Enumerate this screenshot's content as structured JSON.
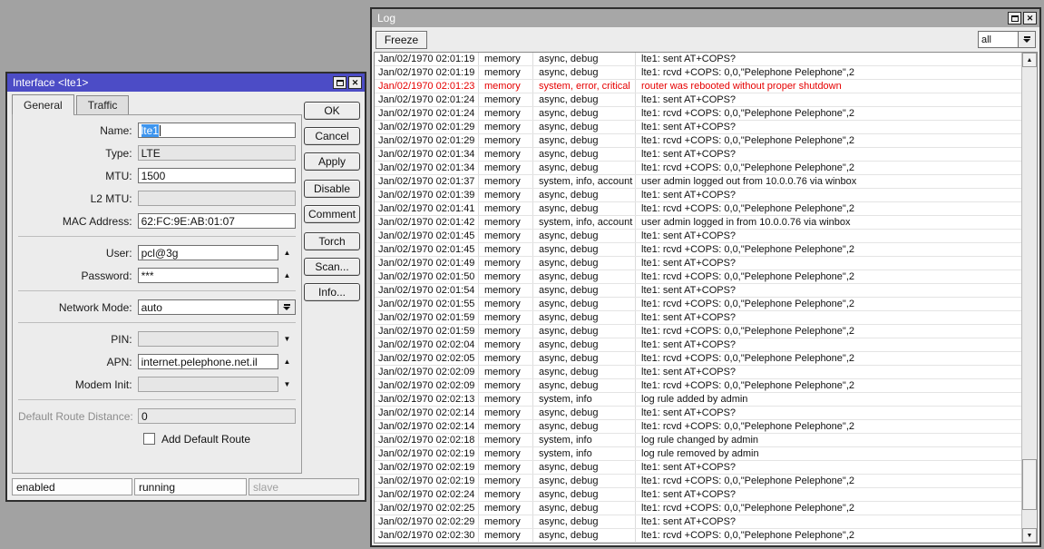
{
  "colors": {
    "desktop_bg": "#a2a2a2",
    "active_titlebar": "#4c4cc6",
    "inactive_titlebar": "#a7a7a7",
    "error_text": "#e60000",
    "selection_bg": "#3d95ef"
  },
  "icons": {
    "close": "✕",
    "maximize": "window-maximize-box",
    "up_triangle": "▲",
    "down_triangle": "▼",
    "scroll_up": "▲",
    "scroll_down": "▼",
    "dropdown": "bar-over-down-triangle"
  },
  "interface_dialog": {
    "title": "Interface <lte1>",
    "tabs": [
      {
        "label": "General",
        "active": true
      },
      {
        "label": "Traffic",
        "active": false
      }
    ],
    "fields": [
      {
        "label": "Name:",
        "value": "lte1",
        "state": "selected",
        "arrow": "none",
        "dropdown": false,
        "sep_before": false,
        "muted_label": false
      },
      {
        "label": "Type:",
        "value": "LTE",
        "state": "disabled",
        "arrow": "none",
        "dropdown": false,
        "sep_before": false,
        "muted_label": false
      },
      {
        "label": "MTU:",
        "value": "1500",
        "state": "normal",
        "arrow": "none",
        "dropdown": false,
        "sep_before": false,
        "muted_label": false
      },
      {
        "label": "L2 MTU:",
        "value": "",
        "state": "disabled",
        "arrow": "none",
        "dropdown": false,
        "sep_before": false,
        "muted_label": false
      },
      {
        "label": "MAC Address:",
        "value": "62:FC:9E:AB:01:07",
        "state": "normal",
        "arrow": "none",
        "dropdown": false,
        "sep_before": false,
        "muted_label": false
      },
      {
        "label": "User:",
        "value": "pcl@3g",
        "state": "normal",
        "arrow": "up",
        "dropdown": false,
        "sep_before": true,
        "muted_label": false
      },
      {
        "label": "Password:",
        "value": "***",
        "state": "normal",
        "arrow": "up",
        "dropdown": false,
        "sep_before": false,
        "muted_label": false
      },
      {
        "label": "Network Mode:",
        "value": "auto",
        "state": "normal",
        "arrow": "none",
        "dropdown": true,
        "sep_before": true,
        "muted_label": false
      },
      {
        "label": "PIN:",
        "value": "",
        "state": "disabled",
        "arrow": "down",
        "dropdown": false,
        "sep_before": true,
        "muted_label": false
      },
      {
        "label": "APN:",
        "value": "internet.pelephone.net.il",
        "state": "normal",
        "arrow": "up",
        "dropdown": false,
        "sep_before": false,
        "muted_label": false
      },
      {
        "label": "Modem Init:",
        "value": "",
        "state": "disabled",
        "arrow": "down",
        "dropdown": false,
        "sep_before": false,
        "muted_label": false
      },
      {
        "label": "Default Route Distance:",
        "value": "0",
        "state": "readonly",
        "arrow": "none",
        "dropdown": false,
        "sep_before": true,
        "muted_label": true
      }
    ],
    "checkbox": {
      "label": "Add Default Route",
      "checked": false
    },
    "action_buttons": [
      {
        "label": "OK",
        "gap_before": false
      },
      {
        "label": "Cancel",
        "gap_before": false
      },
      {
        "label": "Apply",
        "gap_before": false
      },
      {
        "label": "Disable",
        "gap_before": true
      },
      {
        "label": "Comment",
        "gap_before": false
      },
      {
        "label": "Torch",
        "gap_before": true
      },
      {
        "label": "Scan...",
        "gap_before": false
      },
      {
        "label": "Info...",
        "gap_before": false
      }
    ],
    "status_cells": [
      {
        "label": "enabled",
        "muted": false
      },
      {
        "label": "running",
        "muted": false
      },
      {
        "label": "slave",
        "muted": true
      }
    ]
  },
  "log_window": {
    "title": "Log",
    "toolbar": {
      "freeze_label": "Freeze",
      "filter_value": "all"
    },
    "columns": [
      "time",
      "buffer",
      "topics",
      "message"
    ],
    "rows": [
      {
        "time": "Jan/02/1970 02:01:19",
        "buffer": "memory",
        "topics": "async, debug",
        "message": "lte1: sent AT+COPS?",
        "error": false
      },
      {
        "time": "Jan/02/1970 02:01:19",
        "buffer": "memory",
        "topics": "async, debug",
        "message": "lte1: rcvd +COPS: 0,0,\"Pelephone Pelephone\",2",
        "error": false
      },
      {
        "time": "Jan/02/1970 02:01:23",
        "buffer": "memory",
        "topics": "system, error, critical",
        "message": "router was rebooted without proper shutdown",
        "error": true
      },
      {
        "time": "Jan/02/1970 02:01:24",
        "buffer": "memory",
        "topics": "async, debug",
        "message": "lte1: sent AT+COPS?",
        "error": false
      },
      {
        "time": "Jan/02/1970 02:01:24",
        "buffer": "memory",
        "topics": "async, debug",
        "message": "lte1: rcvd +COPS: 0,0,\"Pelephone Pelephone\",2",
        "error": false
      },
      {
        "time": "Jan/02/1970 02:01:29",
        "buffer": "memory",
        "topics": "async, debug",
        "message": "lte1: sent AT+COPS?",
        "error": false
      },
      {
        "time": "Jan/02/1970 02:01:29",
        "buffer": "memory",
        "topics": "async, debug",
        "message": "lte1: rcvd +COPS: 0,0,\"Pelephone Pelephone\",2",
        "error": false
      },
      {
        "time": "Jan/02/1970 02:01:34",
        "buffer": "memory",
        "topics": "async, debug",
        "message": "lte1: sent AT+COPS?",
        "error": false
      },
      {
        "time": "Jan/02/1970 02:01:34",
        "buffer": "memory",
        "topics": "async, debug",
        "message": "lte1: rcvd +COPS: 0,0,\"Pelephone Pelephone\",2",
        "error": false
      },
      {
        "time": "Jan/02/1970 02:01:37",
        "buffer": "memory",
        "topics": "system, info, account",
        "message": "user admin logged out from 10.0.0.76 via winbox",
        "error": false
      },
      {
        "time": "Jan/02/1970 02:01:39",
        "buffer": "memory",
        "topics": "async, debug",
        "message": "lte1: sent AT+COPS?",
        "error": false
      },
      {
        "time": "Jan/02/1970 02:01:41",
        "buffer": "memory",
        "topics": "async, debug",
        "message": "lte1: rcvd +COPS: 0,0,\"Pelephone Pelephone\",2",
        "error": false
      },
      {
        "time": "Jan/02/1970 02:01:42",
        "buffer": "memory",
        "topics": "system, info, account",
        "message": "user admin logged in from 10.0.0.76 via winbox",
        "error": false
      },
      {
        "time": "Jan/02/1970 02:01:45",
        "buffer": "memory",
        "topics": "async, debug",
        "message": "lte1: sent AT+COPS?",
        "error": false
      },
      {
        "time": "Jan/02/1970 02:01:45",
        "buffer": "memory",
        "topics": "async, debug",
        "message": "lte1: rcvd +COPS: 0,0,\"Pelephone Pelephone\",2",
        "error": false
      },
      {
        "time": "Jan/02/1970 02:01:49",
        "buffer": "memory",
        "topics": "async, debug",
        "message": "lte1: sent AT+COPS?",
        "error": false
      },
      {
        "time": "Jan/02/1970 02:01:50",
        "buffer": "memory",
        "topics": "async, debug",
        "message": "lte1: rcvd +COPS: 0,0,\"Pelephone Pelephone\",2",
        "error": false
      },
      {
        "time": "Jan/02/1970 02:01:54",
        "buffer": "memory",
        "topics": "async, debug",
        "message": "lte1: sent AT+COPS?",
        "error": false
      },
      {
        "time": "Jan/02/1970 02:01:55",
        "buffer": "memory",
        "topics": "async, debug",
        "message": "lte1: rcvd +COPS: 0,0,\"Pelephone Pelephone\",2",
        "error": false
      },
      {
        "time": "Jan/02/1970 02:01:59",
        "buffer": "memory",
        "topics": "async, debug",
        "message": "lte1: sent AT+COPS?",
        "error": false
      },
      {
        "time": "Jan/02/1970 02:01:59",
        "buffer": "memory",
        "topics": "async, debug",
        "message": "lte1: rcvd +COPS: 0,0,\"Pelephone Pelephone\",2",
        "error": false
      },
      {
        "time": "Jan/02/1970 02:02:04",
        "buffer": "memory",
        "topics": "async, debug",
        "message": "lte1: sent AT+COPS?",
        "error": false
      },
      {
        "time": "Jan/02/1970 02:02:05",
        "buffer": "memory",
        "topics": "async, debug",
        "message": "lte1: rcvd +COPS: 0,0,\"Pelephone Pelephone\",2",
        "error": false
      },
      {
        "time": "Jan/02/1970 02:02:09",
        "buffer": "memory",
        "topics": "async, debug",
        "message": "lte1: sent AT+COPS?",
        "error": false
      },
      {
        "time": "Jan/02/1970 02:02:09",
        "buffer": "memory",
        "topics": "async, debug",
        "message": "lte1: rcvd +COPS: 0,0,\"Pelephone Pelephone\",2",
        "error": false
      },
      {
        "time": "Jan/02/1970 02:02:13",
        "buffer": "memory",
        "topics": "system, info",
        "message": "log rule added by admin",
        "error": false
      },
      {
        "time": "Jan/02/1970 02:02:14",
        "buffer": "memory",
        "topics": "async, debug",
        "message": "lte1: sent AT+COPS?",
        "error": false
      },
      {
        "time": "Jan/02/1970 02:02:14",
        "buffer": "memory",
        "topics": "async, debug",
        "message": "lte1: rcvd +COPS: 0,0,\"Pelephone Pelephone\",2",
        "error": false
      },
      {
        "time": "Jan/02/1970 02:02:18",
        "buffer": "memory",
        "topics": "system, info",
        "message": "log rule changed by admin",
        "error": false
      },
      {
        "time": "Jan/02/1970 02:02:19",
        "buffer": "memory",
        "topics": "system, info",
        "message": "log rule removed by admin",
        "error": false
      },
      {
        "time": "Jan/02/1970 02:02:19",
        "buffer": "memory",
        "topics": "async, debug",
        "message": "lte1: sent AT+COPS?",
        "error": false
      },
      {
        "time": "Jan/02/1970 02:02:19",
        "buffer": "memory",
        "topics": "async, debug",
        "message": "lte1: rcvd +COPS: 0,0,\"Pelephone Pelephone\",2",
        "error": false
      },
      {
        "time": "Jan/02/1970 02:02:24",
        "buffer": "memory",
        "topics": "async, debug",
        "message": "lte1: sent AT+COPS?",
        "error": false
      },
      {
        "time": "Jan/02/1970 02:02:25",
        "buffer": "memory",
        "topics": "async, debug",
        "message": "lte1: rcvd +COPS: 0,0,\"Pelephone Pelephone\",2",
        "error": false
      },
      {
        "time": "Jan/02/1970 02:02:29",
        "buffer": "memory",
        "topics": "async, debug",
        "message": "lte1: sent AT+COPS?",
        "error": false
      },
      {
        "time": "Jan/02/1970 02:02:30",
        "buffer": "memory",
        "topics": "async, debug",
        "message": "lte1: rcvd +COPS: 0,0,\"Pelephone Pelephone\",2",
        "error": false
      }
    ]
  }
}
